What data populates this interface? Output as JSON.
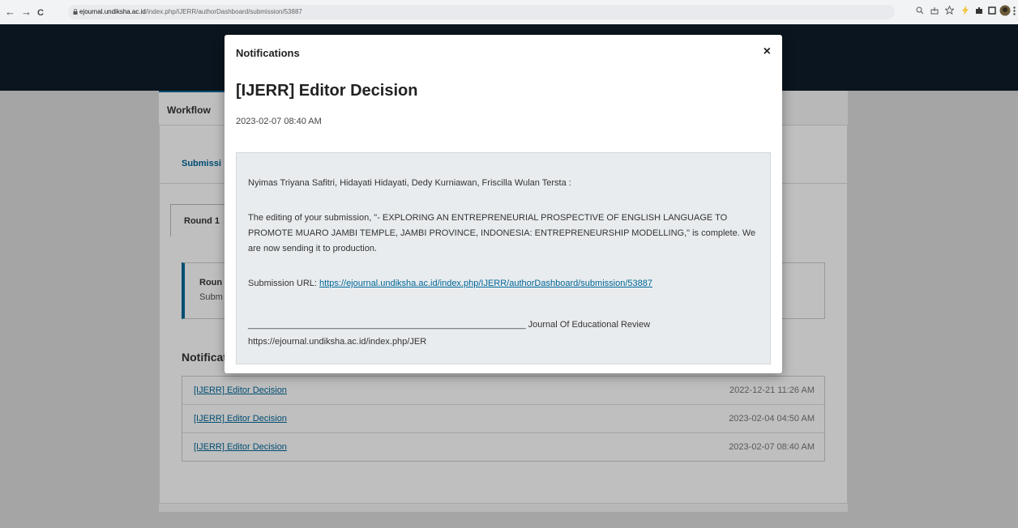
{
  "browser": {
    "url_host": "ejournal.undiksha.ac.id",
    "url_path": "/index.php/IJERR/authorDashboard/submission/53887",
    "back": "←",
    "forward": "→",
    "reload": "C"
  },
  "page": {
    "workflow_tab": "Workflow",
    "submission_tab": "Submissi",
    "round_tab": "Round 1",
    "round_box_title": "Roun",
    "round_box_sub": "Subm",
    "notifications_heading": "Notifications",
    "notifications": [
      {
        "label": "[IJERR] Editor Decision",
        "date": "2022-12-21 11:26 AM"
      },
      {
        "label": "[IJERR] Editor Decision",
        "date": "2023-02-04 04:50 AM"
      },
      {
        "label": "[IJERR] Editor Decision",
        "date": "2023-02-07 08:40 AM"
      }
    ]
  },
  "modal": {
    "title": "Notifications",
    "close": "×",
    "notification_title": "[IJERR] Editor Decision",
    "date": "2023-02-07 08:40 AM",
    "recipients": "Nyimas Triyana Safitri, Hidayati Hidayati, Dedy Kurniawan, Friscilla Wulan Tersta :",
    "body": "The editing of your submission, \"- EXPLORING AN ENTREPRENEURIAL PROSPECTIVE OF ENGLISH LANGUAGE TO PROMOTE MUARO JAMBI TEMPLE, JAMBI PROVINCE, INDONESIA: ENTREPRENEURSHIP MODELLING,\" is complete. We are now sending it to production.",
    "url_label": "Submission URL: ",
    "url": "https://ejournal.undiksha.ac.id/index.php/IJERR/authorDashboard/submission/53887",
    "signature_line": "________________________________________________________ Journal Of Educational Review",
    "signature_url": "https://ejournal.undiksha.ac.id/index.php/JER"
  }
}
